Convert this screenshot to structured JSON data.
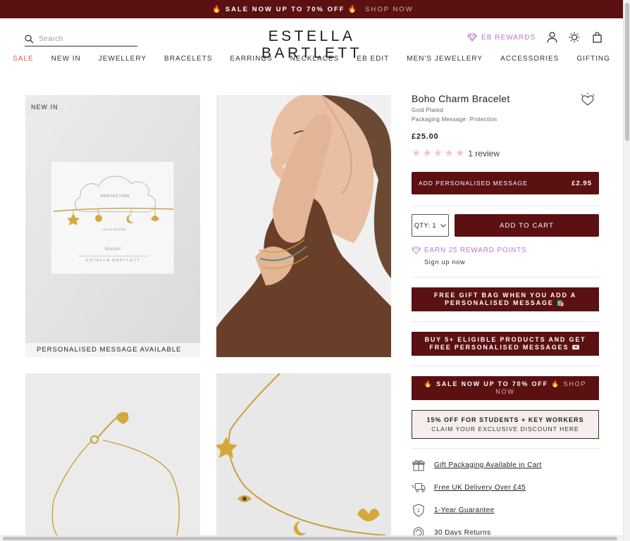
{
  "promo": {
    "icon": "flame-icon",
    "bold": "SALE NOW UP TO 70% OFF",
    "link": "SHOP NOW"
  },
  "search": {
    "placeholder": "Search",
    "icon": "search-icon"
  },
  "logo": "ESTELLA BARTLETT",
  "header": {
    "rewards_label": "EB REWARDS",
    "icons": [
      "diamond-icon",
      "account-icon",
      "brightness-icon",
      "bag-icon"
    ]
  },
  "nav": {
    "items": [
      "SALE",
      "NEW IN",
      "JEWELLERY",
      "BRACELETS",
      "EARRINGS",
      "NECKLACES",
      "EB EDIT",
      "MEN'S JEWELLERY",
      "ACCESSORIES",
      "GIFTING"
    ]
  },
  "gallery": {
    "badge": "NEW IN",
    "personalised_strip": "PERSONALISED MESSAGE AVAILABLE",
    "card_texts": {
      "protection": "PROTECTION",
      "plated": "GOLD PLATED",
      "item": "Bracelet",
      "brand": "ESTELLA BARTLETT"
    }
  },
  "product": {
    "title": "Boho Charm Bracelet",
    "finish": "Gold Plated",
    "packaging": "Packaging Message: Protection",
    "price": "£25.00",
    "rating": 5,
    "review_count": "1 review",
    "personalise_label": "ADD PERSONALISED MESSAGE",
    "personalise_price": "£2.95",
    "qty_label": "QTY: 1",
    "add_to_cart": "ADD TO CART",
    "earn_points": "EARN 25 REWARD POINTS",
    "signup": "Sign up now",
    "banner_giftbag": "FREE GIFT BAG WHEN YOU ADD A PERSONALISED MESSAGE 🛍️",
    "banner_buy5": "BUY 5+ ELIGIBLE PRODUCTS AND GET FREE PERSONALISED MESSAGES 💌",
    "banner_sale_bold": "SALE NOW UP TO 70% OFF",
    "banner_sale_link": "SHOP NOW",
    "student_line1": "15% OFF FOR STUDENTS + KEY WORKERS",
    "student_line2": "CLAIM YOUR EXCLUSIVE DISCOUNT HERE",
    "features": [
      {
        "icon": "gift-icon",
        "label": "Gift Packaging Available in Cart"
      },
      {
        "icon": "delivery-truck-icon",
        "label": "Free UK Delivery Over £45"
      },
      {
        "icon": "shield-icon",
        "label": "1-Year Guarantee"
      },
      {
        "icon": "returns-icon",
        "label": "30 Days Returns"
      }
    ]
  },
  "colors": {
    "brand": "#5b1011",
    "accent": "#b77bc9",
    "sale": "#d85f56",
    "star": "#f1c7c7"
  }
}
